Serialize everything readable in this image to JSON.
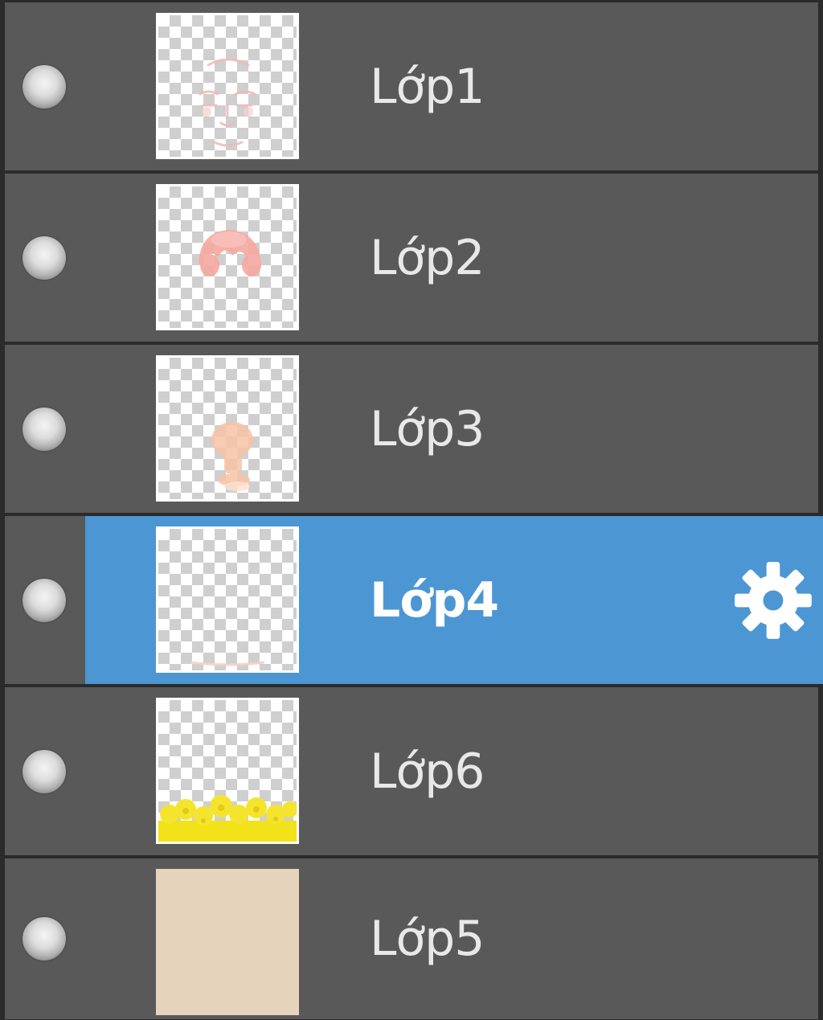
{
  "layers_panel": {
    "layers": [
      {
        "name": "Lớp1",
        "selected": false,
        "thumbnail": "face-lines-sketch"
      },
      {
        "name": "Lớp2",
        "selected": false,
        "thumbnail": "pink-hair-blob"
      },
      {
        "name": "Lớp3",
        "selected": false,
        "thumbnail": "skin-figure-blob"
      },
      {
        "name": "Lớp4",
        "selected": true,
        "thumbnail": "mostly-empty-with-bottom-stroke"
      },
      {
        "name": "Lớp6",
        "selected": false,
        "thumbnail": "yellow-flowers-bottom"
      },
      {
        "name": "Lớp5",
        "selected": false,
        "thumbnail": "solid-beige-fill"
      }
    ],
    "selected_icon": "gear-icon",
    "colors": {
      "panel_background": "#2b2b2b",
      "row_background": "#595959",
      "selected_background": "#4c96d3",
      "text": "#e8e8e8",
      "beige_fill": "#e6d3bc",
      "yellow_flowers": "#f2e21a"
    }
  }
}
